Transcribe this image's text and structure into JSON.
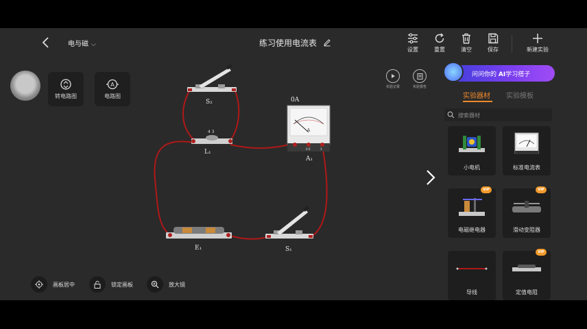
{
  "header": {
    "subject": "电与磁",
    "title": "练习使用电流表",
    "toolbar": [
      {
        "label": "设置",
        "icon": "sliders-icon"
      },
      {
        "label": "重置",
        "icon": "refresh-icon"
      },
      {
        "label": "清空",
        "icon": "trash-icon"
      },
      {
        "label": "保存",
        "icon": "save-icon"
      },
      {
        "label": "新建实验",
        "icon": "plus-icon"
      }
    ]
  },
  "tools": {
    "convert_label": "转电路图",
    "circuit_label": "电路图"
  },
  "side_controls": {
    "record_label": "实验记录",
    "report_label": "实验报告"
  },
  "ai_banner": {
    "prefix": "问问你的",
    "ai": "AI",
    "suffix": "学习搭子"
  },
  "panel": {
    "tab_active": "实验器材",
    "tab_inactive": "实验模板",
    "search_placeholder": "搜索器材",
    "items": [
      {
        "name": "小电机",
        "vip": false
      },
      {
        "name": "标准电流表",
        "vip": false
      },
      {
        "name": "电磁继电器",
        "vip": true
      },
      {
        "name": "滑动变阻器",
        "vip": true
      },
      {
        "name": "导线",
        "vip": false
      },
      {
        "name": "定值电阻",
        "vip": true
      }
    ],
    "vip_label": "VIP"
  },
  "circuit": {
    "ammeter_reading": "0A",
    "labels": {
      "switch2": "S₂",
      "lamp": "L₁",
      "ammeter": "A₁",
      "battery": "E₁",
      "switch1": "S₁"
    },
    "lamp_terminals": "4 3",
    "ammeter_terminals": [
      "0.6",
      "3"
    ]
  },
  "bottom": {
    "center_label": "画板居中",
    "lock_label": "锁定画板",
    "magnifier_label": "放大镜"
  },
  "colors": {
    "accent": "#f08a2a",
    "wire": "#b01818",
    "background": "#2a2a2a"
  }
}
